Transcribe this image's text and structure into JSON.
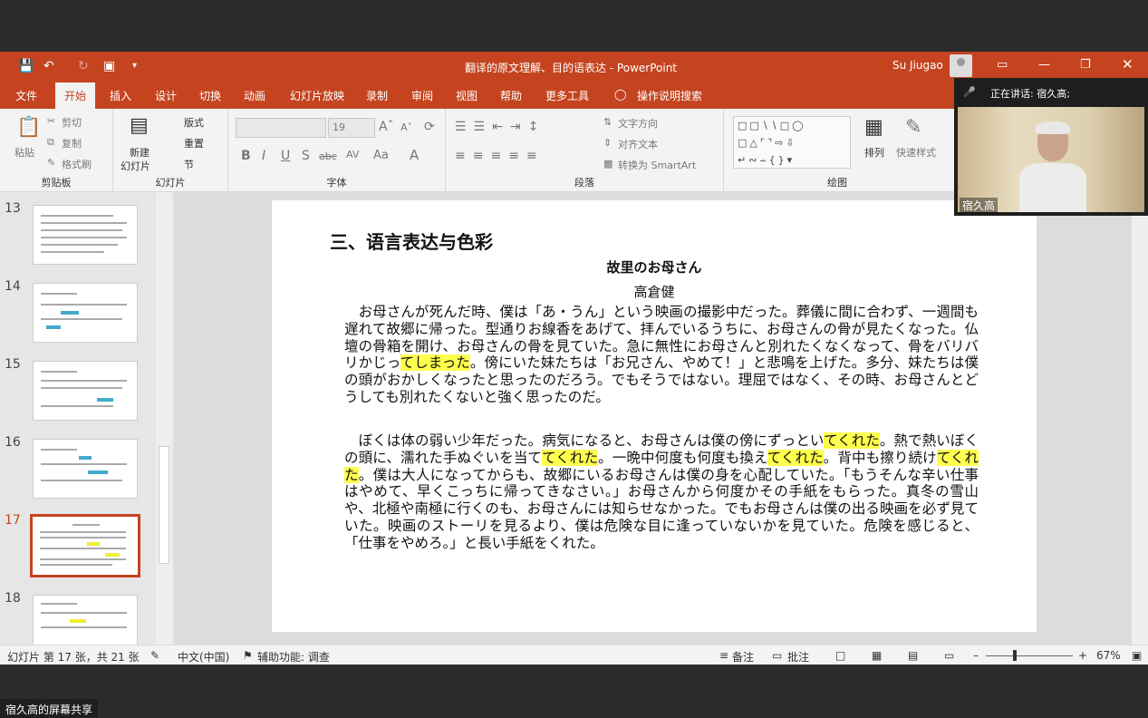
{
  "window": {
    "doc_title": "翻译的原文理解、目的语表达  -  PowerPoint",
    "user": "Su Jiugao"
  },
  "menu": {
    "tabs": [
      "文件",
      "开始",
      "插入",
      "设计",
      "切换",
      "动画",
      "幻灯片放映",
      "录制",
      "审阅",
      "视图",
      "帮助",
      "更多工具"
    ],
    "active": "开始",
    "search": "操作说明搜索"
  },
  "ribbon": {
    "clipboard": {
      "label": "剪贴板",
      "paste": "粘贴",
      "cut": "剪切",
      "copy": "复制",
      "format_painter": "格式刷"
    },
    "slides": {
      "label": "幻灯片",
      "new_slide": "新建",
      "new_slide2": "幻灯片",
      "layout": "版式",
      "reset": "重置",
      "section": "节"
    },
    "font": {
      "label": "字体",
      "size": "19",
      "aa": "Aa"
    },
    "paragraph": {
      "label": "段落",
      "text_direction": "文字方向",
      "align_text": "对齐文本",
      "smartart": "转换为 SmartArt"
    },
    "drawing": {
      "label": "绘图",
      "arrange": "排列",
      "quick_styles": "快速样式"
    }
  },
  "thumbnails": [
    {
      "num": "13"
    },
    {
      "num": "14"
    },
    {
      "num": "15"
    },
    {
      "num": "16"
    },
    {
      "num": "17",
      "active": true
    },
    {
      "num": "18"
    }
  ],
  "slide": {
    "heading": "三、语言表达与色彩",
    "title": "故里のお母さん",
    "author": "高倉健",
    "p1_a": "　お母さんが死んだ時、僕は「あ・うん」という映画の撮影中だった。葬儀に間に合わず、一週間も遅れて故郷に帰った。型通りお線香をあげて、拝んでいるうちに、お母さんの骨が見たくなった。仏壇の骨箱を開け、お母さんの骨を見ていた。急に無性にお母さんと別れたくなくなって、骨をバリバリかじっ",
    "p1_h1": "てしまった",
    "p1_b": "。傍にいた妹たちは「お兄さん、やめて！」と悲鳴を上げた。多分、妹たちは僕の頭がおかしくなったと思ったのだろう。でもそうではない。理屈ではなく、その時、お母さんとどうしても別れたくないと強く思ったのだ。",
    "p2_a": "　ぼくは体の弱い少年だった。病気になると、お母さんは僕の傍にずっとい",
    "p2_h1": "てくれた",
    "p2_b": "。熱で熱いぼくの頭に、濡れた手ぬぐいを当て",
    "p2_h2": "てくれた",
    "p2_c": "。一晩中何度も何度も換え",
    "p2_h3": "てくれた",
    "p2_d": "。背中も擦り続け",
    "p2_h4": "てくれた",
    "p2_e": "。僕は大人になってからも、故郷にいるお母さんは僕の身を心配していた。「もうそんな辛い仕事はやめて、早くこっちに帰ってきなさい。」お母さんから何度かその手紙をもらった。真冬の雪山や、北極や南極に行くのも、お母さんには知らせなかった。でもお母さんは僕の出る映画を必ず見ていた。映画のストーリを見るより、僕は危険な目に逢っていないかを見ていた。危険を感じると、「仕事をやめろ。」と長い手紙をくれた。"
  },
  "status": {
    "slide_info": "幻灯片 第 17 张，共 21 张",
    "language": "中文(中国)",
    "accessibility": "辅助功能: 调查",
    "notes": "备注",
    "comments": "批注",
    "zoom": "67%"
  },
  "meeting": {
    "speaking": "正在讲话: 宿久高;",
    "participant": "宿久高",
    "share_label": "宿久高的屏幕共享"
  },
  "colors": {
    "accent": "#c5441f",
    "highlight": "#ffff4d"
  }
}
